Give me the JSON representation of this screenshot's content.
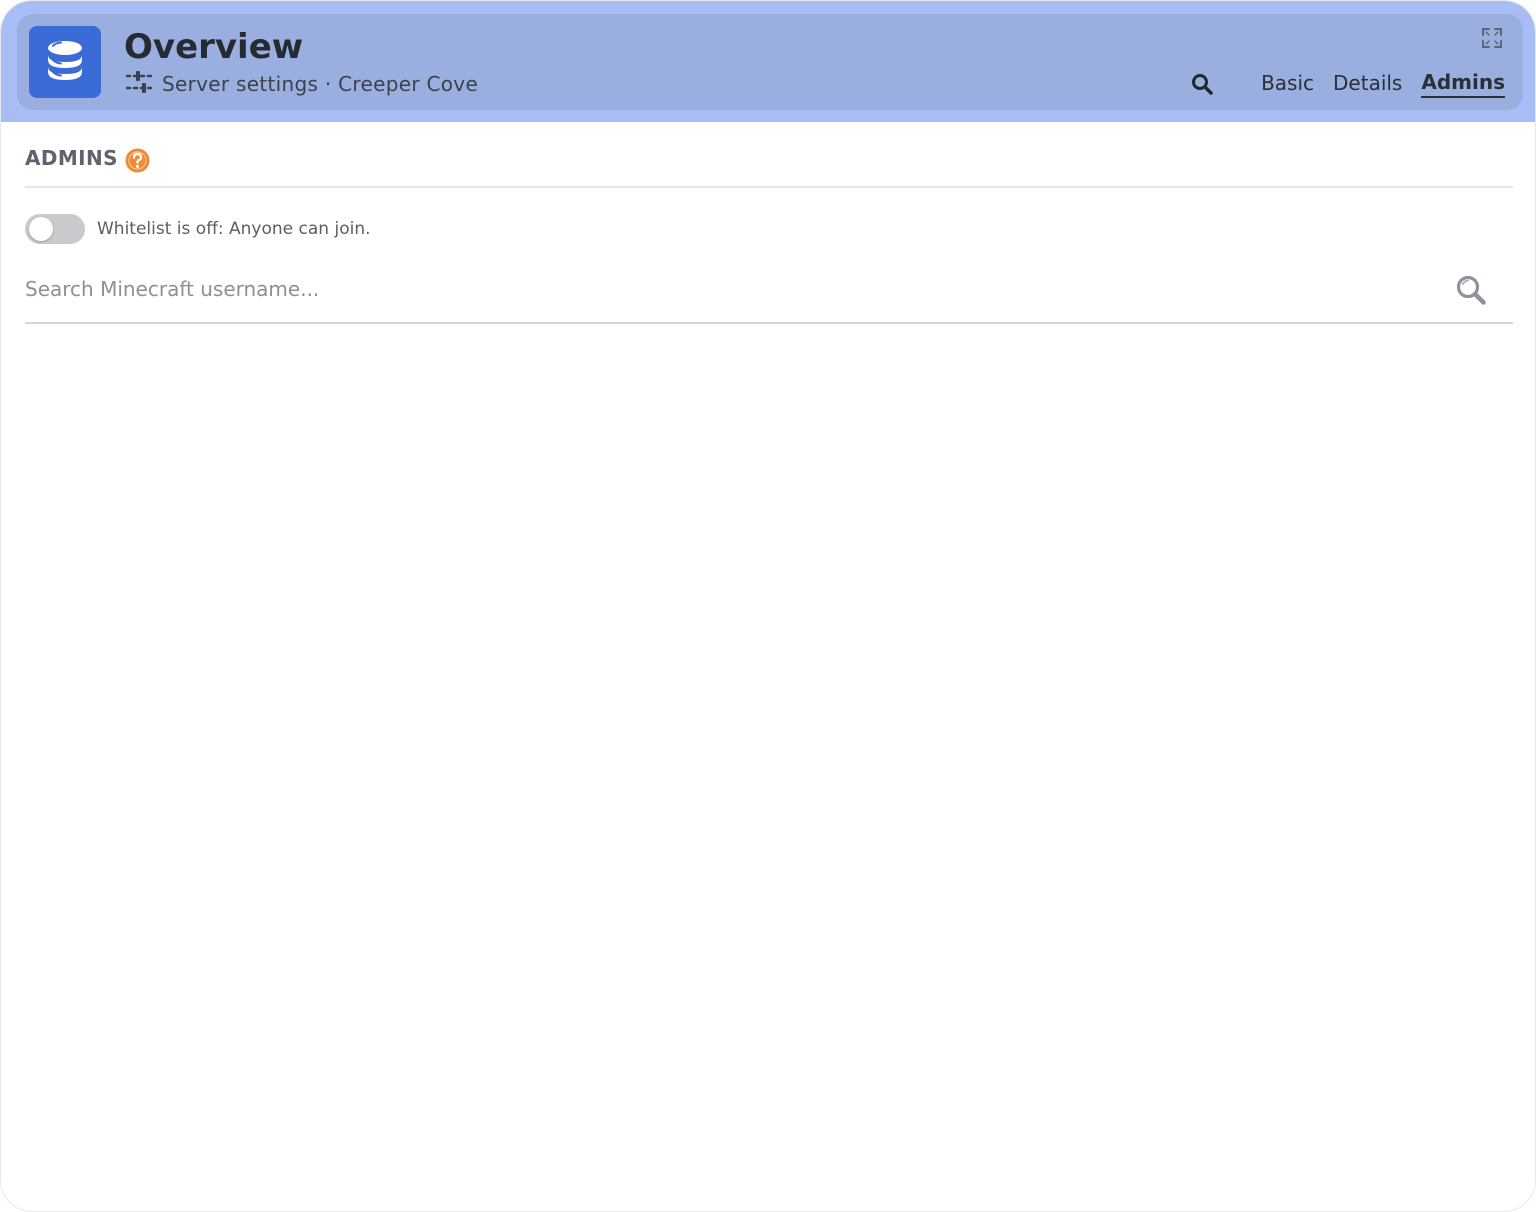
{
  "header": {
    "title": "Overview",
    "subtitle": "Server settings · Creeper Cove",
    "tabs": [
      {
        "label": "Basic",
        "active": false
      },
      {
        "label": "Details",
        "active": false
      },
      {
        "label": "Admins",
        "active": true
      }
    ]
  },
  "section": {
    "title": "ADMINS"
  },
  "whitelist": {
    "enabled": false,
    "label": "Whitelist is off: Anyone can join."
  },
  "search": {
    "placeholder": "Search Minecraft username...",
    "value": ""
  },
  "icons": {
    "app": "database-icon",
    "subtitle": "sliders-icon",
    "expand": "expand-icon",
    "search": "search-icon",
    "help": "help-icon"
  },
  "colors": {
    "header_band": "#a8bdf5",
    "header_card": "#9aafdf",
    "app_icon_bg": "#3a6bd6",
    "help_accent": "#f08a33",
    "toggle_off": "#c9cacd"
  }
}
